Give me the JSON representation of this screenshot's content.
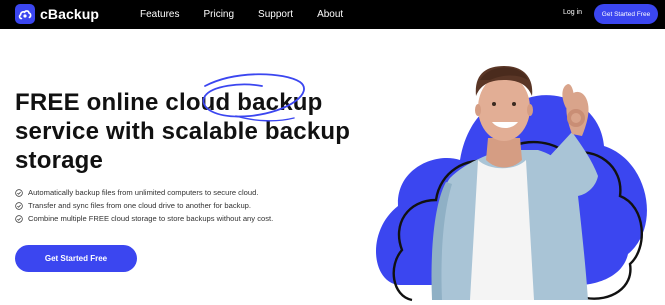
{
  "brand": {
    "name": "cBackup",
    "accent": "#3b46f0"
  },
  "nav": {
    "items": [
      {
        "label": "Features"
      },
      {
        "label": "Pricing"
      },
      {
        "label": "Support"
      },
      {
        "label": "About"
      }
    ],
    "login": "Log in",
    "cta": "Get Started Free"
  },
  "hero": {
    "headline": "FREE online cloud backup service with scalable backup storage",
    "features": [
      {
        "text": "Automatically backup files from unlimited computers to secure cloud.",
        "icon": "check-circle-icon"
      },
      {
        "text": "Transfer and sync files from one cloud drive to another for backup.",
        "icon": "check-circle-icon"
      },
      {
        "text": "Combine multiple FREE cloud storage to store backups without any cost.",
        "icon": "check-circle-icon"
      }
    ],
    "cta": "Get Started Free",
    "illustration": "man-ok-gesture-on-cloud"
  }
}
